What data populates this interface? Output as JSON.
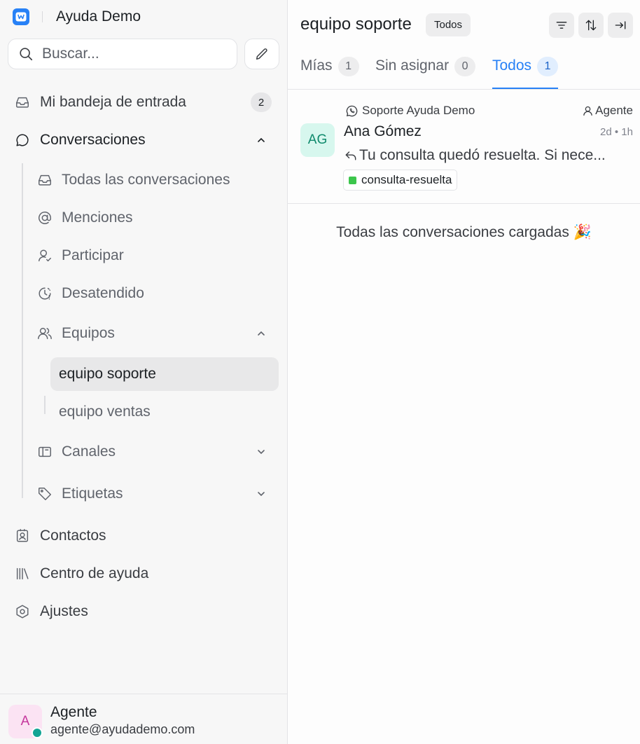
{
  "sidebar": {
    "brand": "Ayuda Demo",
    "search_placeholder": "Buscar...",
    "inbox": {
      "label": "Mi bandeja de entrada",
      "count": "2"
    },
    "conversations": {
      "label": "Conversaciones",
      "items": [
        "Todas las conversaciones",
        "Menciones",
        "Participar",
        "Desatendido"
      ]
    },
    "teams": {
      "label": "Equipos",
      "items": [
        "equipo soporte",
        "equipo ventas"
      ],
      "active": "equipo soporte"
    },
    "channels_label": "Canales",
    "labels_label": "Etiquetas",
    "bottom": [
      "Contactos",
      "Centro de ayuda",
      "Ajustes"
    ],
    "user": {
      "initial": "A",
      "name": "Agente",
      "email": "agente@ayudademo.com"
    }
  },
  "main": {
    "title": "equipo soporte",
    "filter_badge": "Todos",
    "tabs": [
      {
        "label": "Mías",
        "count": "1"
      },
      {
        "label": "Sin asignar",
        "count": "0"
      },
      {
        "label": "Todos",
        "count": "1",
        "active": true
      }
    ],
    "conversation": {
      "inbox": "Soporte Ayuda Demo",
      "agent": "Agente",
      "initials": "AG",
      "name": "Ana Gómez",
      "time": "2d • 1h",
      "message": "Tu consulta quedó resuelta. Si nece...",
      "label": "consulta-resuelta",
      "label_color": "#3cc64c"
    },
    "loaded_text": "Todas las conversaciones cargadas 🎉"
  },
  "colors": {
    "accent": "#2781f6",
    "sidebar_bg": "#f7f7f7"
  }
}
